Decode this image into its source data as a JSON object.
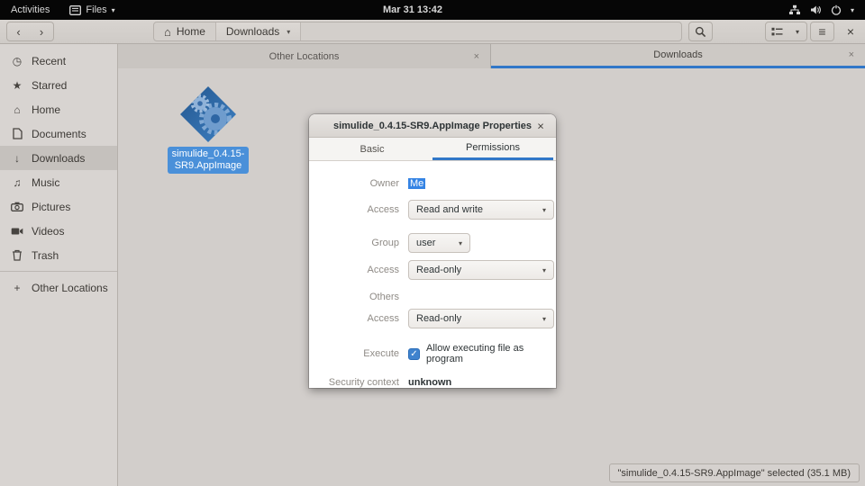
{
  "topbar": {
    "activities": "Activities",
    "app_name": "Files",
    "clock": "Mar 31 13:42"
  },
  "toolbar": {
    "path_home": "Home",
    "path_current": "Downloads"
  },
  "window_tabs": [
    {
      "label": "Other Locations"
    },
    {
      "label": "Downloads"
    }
  ],
  "sidebar": {
    "items": [
      {
        "label": "Recent"
      },
      {
        "label": "Starred"
      },
      {
        "label": "Home"
      },
      {
        "label": "Documents"
      },
      {
        "label": "Downloads"
      },
      {
        "label": "Music"
      },
      {
        "label": "Pictures"
      },
      {
        "label": "Videos"
      },
      {
        "label": "Trash"
      },
      {
        "label": "Other Locations"
      }
    ]
  },
  "file": {
    "name_line1": "simulide_0.4.15-",
    "name_line2": "SR9.AppImage"
  },
  "statusbar": {
    "text": "\"simulide_0.4.15-SR9.AppImage\" selected (35.1 MB)"
  },
  "dialog": {
    "title": "simulide_0.4.15-SR9.AppImage Properties",
    "tab_basic": "Basic",
    "tab_permissions": "Permissions",
    "owner_label": "Owner",
    "owner_value": "Me",
    "owner_access_label": "Access",
    "owner_access_value": "Read and write",
    "group_label": "Group",
    "group_value": "user",
    "group_access_label": "Access",
    "group_access_value": "Read-only",
    "others_label": "Others",
    "others_access_label": "Access",
    "others_access_value": "Read-only",
    "execute_label": "Execute",
    "execute_option": "Allow executing file as program",
    "security_label": "Security context",
    "security_value": "unknown"
  },
  "icons": {
    "caret": "▾",
    "close": "×",
    "chevron_left": "‹",
    "chevron_right": "›",
    "hamburger": "≡",
    "plus": "+",
    "check": "✓",
    "star": "★",
    "home": "⌂",
    "clock": "◷",
    "music": "♫",
    "download_arrow": "↓"
  },
  "colors": {
    "accent_blue": "#3177c8",
    "selection_blue": "#4a90d9",
    "topbar_bg": "#060606"
  }
}
